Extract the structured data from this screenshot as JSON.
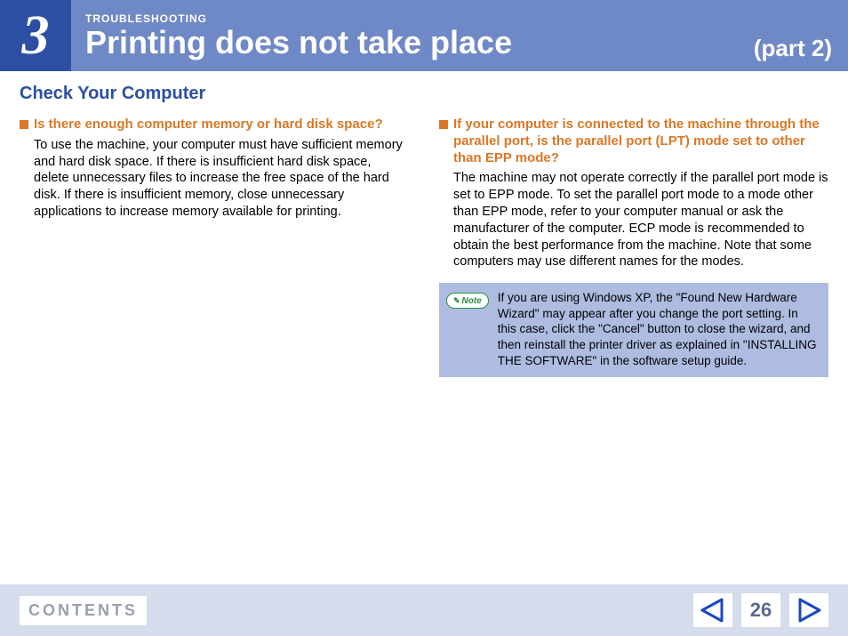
{
  "header": {
    "chapter_number": "3",
    "section_label": "TROUBLESHOOTING",
    "title": "Printing does not take place",
    "part": "(part 2)"
  },
  "subheading": "Check Your Computer",
  "left": {
    "q1": {
      "question": "Is there enough computer memory or hard disk space?",
      "answer": "To use the machine, your computer must have sufficient memory and hard disk space. If there is insufficient hard disk space, delete unnecessary files to increase the free space of the hard disk. If there is insufficient memory, close unnecessary applications to increase memory available for printing."
    }
  },
  "right": {
    "q1": {
      "question": "If your computer is connected to the machine through the parallel port, is the parallel port (LPT) mode set to other than EPP mode?",
      "answer": "The machine may not operate correctly if the parallel port mode is set to EPP mode. To set the parallel port mode to a mode other than EPP mode, refer to your computer manual or ask the manufacturer of the computer. ECP mode is recommended to obtain the best performance from the machine. Note that some computers may use different names for the modes."
    },
    "note": {
      "label": "Note",
      "text": "If you are using Windows XP, the \"Found New Hardware Wizard\" may appear after you change the port setting. In this case, click the \"Cancel\" button to close the wizard, and then reinstall the printer driver as explained in \"INSTALLING THE SOFTWARE\" in the software setup guide."
    }
  },
  "footer": {
    "contents": "CONTENTS",
    "page": "26"
  }
}
